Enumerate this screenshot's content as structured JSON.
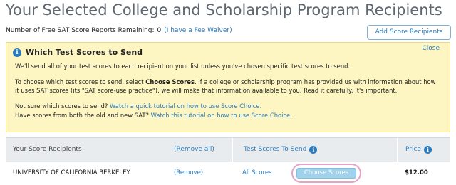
{
  "page": {
    "title": "Your Selected College and Scholarship Program Recipients"
  },
  "reports": {
    "label": "Number of Free SAT Score Reports Remaining:",
    "count": "0",
    "fee_waiver_link": "(I have a Fee Waiver)"
  },
  "add_button": {
    "label": "Add Score Recipients"
  },
  "notice": {
    "title": "Which Test Scores to Send",
    "close_label": "Close",
    "p1": "We'll send all of your test scores to each recipient on your list unless you've chosen specific test scores to send.",
    "p2_pre": "To choose which test scores to send, select ",
    "p2_bold": "Choose Scores",
    "p2_post": ". If a college or scholarship program has provided us with information about how",
    "p2_line2": "it uses SAT scores (its \"SAT score-use practice\"), we will make that information available to you. Read it carefully. It's important.",
    "p3_pre": "Not sure which scores to send? ",
    "p3_link": "Watch a quick tutorial on how to use Score Choice.",
    "p4_pre": "Have scores from both the old and new SAT? ",
    "p4_link": "Watch this tutorial on how to use Score Choice."
  },
  "table": {
    "headers": {
      "recipients": "Your Score Recipients",
      "remove_all": "(Remove all)",
      "scores": "Test Scores To Send",
      "price": "Price"
    },
    "rows": [
      {
        "school": "UNIVERSITY OF CALIFORNIA BERKELEY",
        "remove": "(Remove)",
        "scores": "All Scores",
        "choose_label": "Choose Scores",
        "price": "$12.00"
      }
    ]
  },
  "colors": {
    "link": "#2b7bbd",
    "notice_bg": "#fdf6c2",
    "header_bg": "#e9ecef",
    "choose_btn": "#9fd2ec",
    "highlight_ring": "#e7a3c7"
  },
  "icons": {
    "notice": "info-icon",
    "scores_header": "info-icon",
    "price_header": "info-icon"
  }
}
